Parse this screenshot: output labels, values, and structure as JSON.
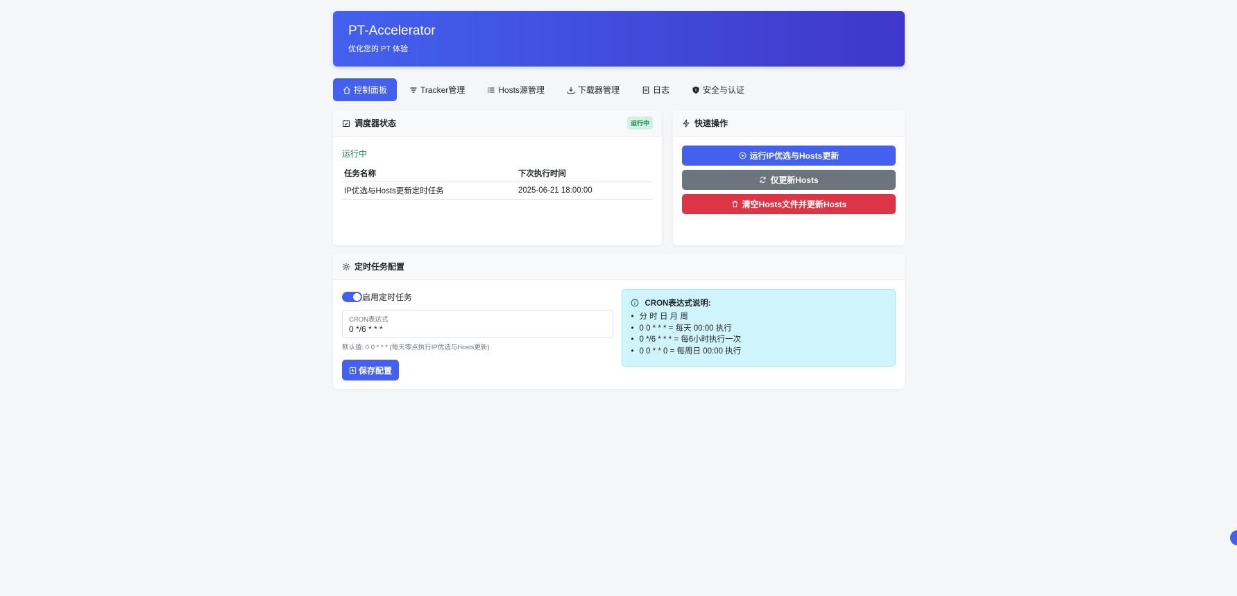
{
  "header": {
    "title": "PT-Accelerator",
    "subtitle": "优化您的 PT 体验"
  },
  "tabs": [
    {
      "label": "控制面板",
      "icon": "home-icon",
      "active": true
    },
    {
      "label": "Tracker管理",
      "icon": "filter-icon"
    },
    {
      "label": "Hosts源管理",
      "icon": "list-icon"
    },
    {
      "label": "下载器管理",
      "icon": "download-icon"
    },
    {
      "label": "日志",
      "icon": "document-icon"
    },
    {
      "label": "安全与认证",
      "icon": "shield-icon"
    }
  ],
  "scheduler": {
    "title": "调度器状态",
    "badge": "运行中",
    "status": "运行中",
    "columns": [
      "任务名称",
      "下次执行时间"
    ],
    "rows": [
      [
        "IP优选与Hosts更新定时任务",
        "2025-06-21 18:00:00"
      ]
    ]
  },
  "quick": {
    "title": "快速操作",
    "buttons": [
      {
        "label": "运行IP优选与Hosts更新",
        "icon": "play-circle-icon",
        "color": "#4361ee"
      },
      {
        "label": "仅更新Hosts",
        "icon": "refresh-icon",
        "color": "#6c757d"
      },
      {
        "label": "清空Hosts文件并更新Hosts",
        "icon": "trash-icon",
        "color": "#dc3545"
      }
    ]
  },
  "config": {
    "title": "定时任务配置",
    "toggle_label": "启用定时任务",
    "toggle_on": true,
    "cron_label": "CRON表达式",
    "cron_value": "0 */6 * * *",
    "help": "默认值: 0 0 * * * (每天零点执行IP优选与Hosts更新)",
    "save_label": "保存配置",
    "info_title": "CRON表达式说明:",
    "info_items": [
      "分 时 日 月 周",
      "0 0 * * * = 每天 00:00 执行",
      "0 */6 * * * = 每6小时执行一次",
      "0 0 * * 0 = 每周日 00:00 执行"
    ]
  },
  "colors": {
    "primary": "#4361ee",
    "success": "#198754",
    "danger": "#dc3545",
    "secondary": "#6c757d"
  }
}
